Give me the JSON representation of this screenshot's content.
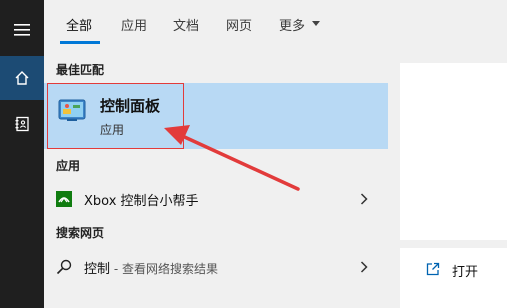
{
  "tabs": [
    {
      "label": "全部",
      "active": true
    },
    {
      "label": "应用",
      "active": false
    },
    {
      "label": "文档",
      "active": false
    },
    {
      "label": "网页",
      "active": false
    },
    {
      "label": "更多",
      "active": false
    }
  ],
  "sections": {
    "best_match": "最佳匹配",
    "apps": "应用",
    "web": "搜索网页"
  },
  "best_match": {
    "title": "控制面板",
    "subtitle": "应用",
    "icon": "control-panel-icon"
  },
  "apps": [
    {
      "label": "Xbox 控制台小帮手",
      "icon": "xbox-icon"
    }
  ],
  "web": [
    {
      "query": "控制",
      "suffix": " - 查看网络搜索结果",
      "icon": "search-icon"
    }
  ],
  "preview": {
    "open_label": "打开"
  },
  "colors": {
    "accent": "#0078d7",
    "selection": "#b8d9f4",
    "annotation": "#e23b3b"
  }
}
